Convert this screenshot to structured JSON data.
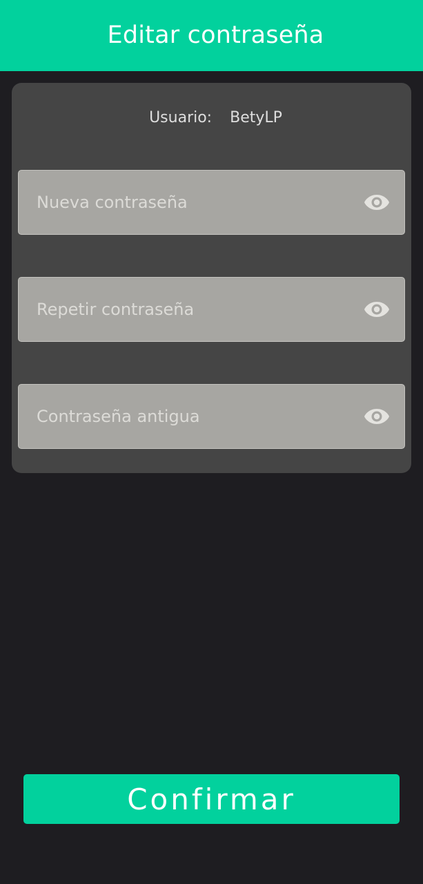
{
  "header": {
    "title": "Editar contraseña"
  },
  "user": {
    "label": "Usuario:",
    "name": "BetyLP"
  },
  "fields": [
    {
      "placeholder": "Nueva contraseña",
      "value": "",
      "icon": "eye-icon"
    },
    {
      "placeholder": "Repetir contraseña",
      "value": "",
      "icon": "eye-icon"
    },
    {
      "placeholder": "Contraseña antigua",
      "value": "",
      "icon": "eye-icon"
    }
  ],
  "confirm": {
    "label": "Confirmar"
  },
  "colors": {
    "accent": "#02d19d",
    "background": "#1e1d21",
    "card": "#454545",
    "field": "#a7a6a2"
  }
}
